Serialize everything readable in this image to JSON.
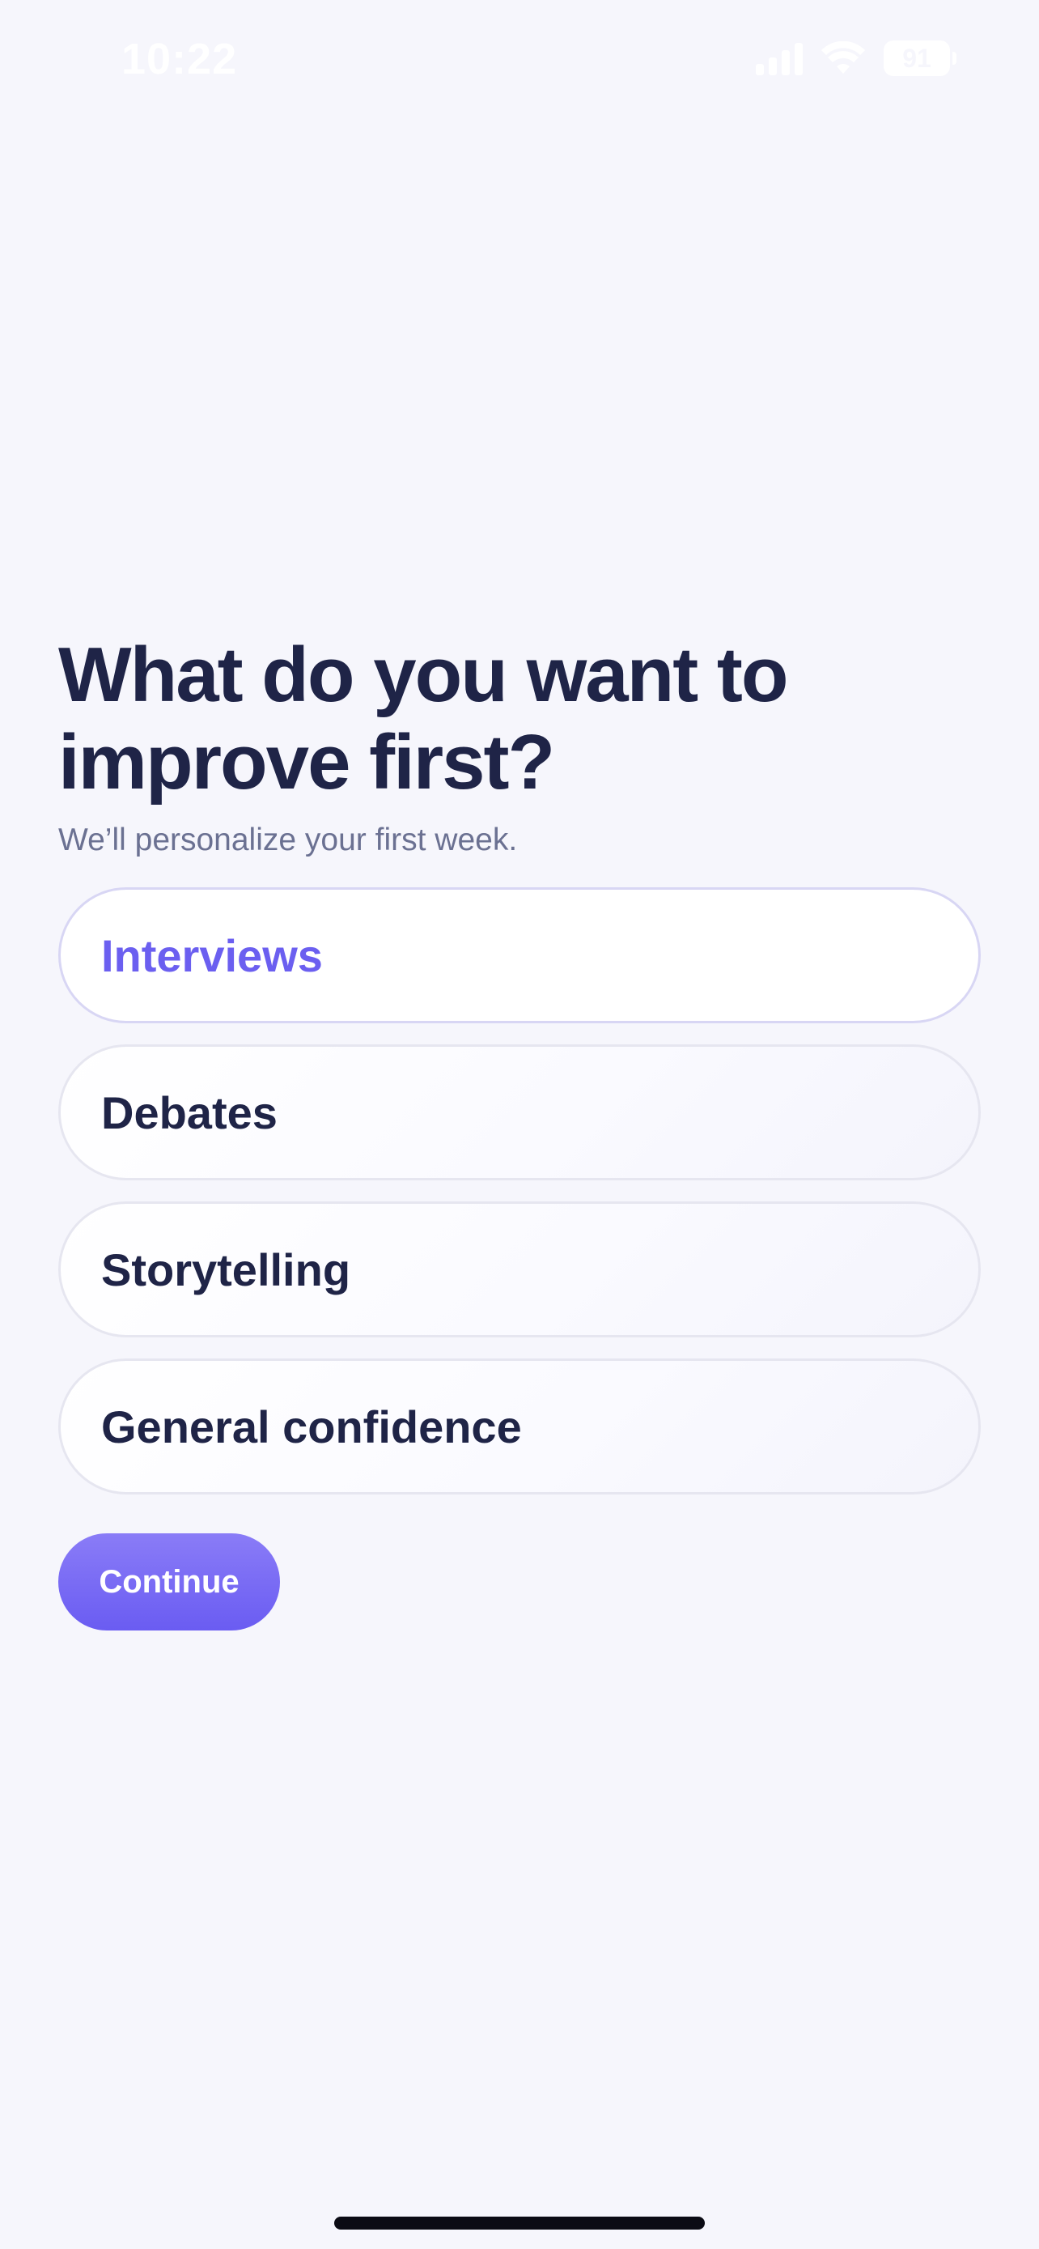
{
  "status_bar": {
    "time": "10:22",
    "battery": "91",
    "icons": [
      "signal-icon",
      "wifi-icon",
      "battery-icon"
    ]
  },
  "screen": {
    "title": "What do you want to improve first?",
    "subtitle": "We’ll personalize your first week.",
    "options": [
      {
        "label": "Interviews",
        "selected": true
      },
      {
        "label": "Debates",
        "selected": false
      },
      {
        "label": "Storytelling",
        "selected": false
      },
      {
        "label": "General confidence",
        "selected": false
      }
    ],
    "continue_label": "Continue"
  },
  "colors": {
    "background": "#f6f6fc",
    "title": "#1f2447",
    "subtitle": "#6b7192",
    "accent": "#6b5ff0",
    "button_gradient_top": "#8a7cf7",
    "button_gradient_bottom": "#6a5cf2"
  }
}
